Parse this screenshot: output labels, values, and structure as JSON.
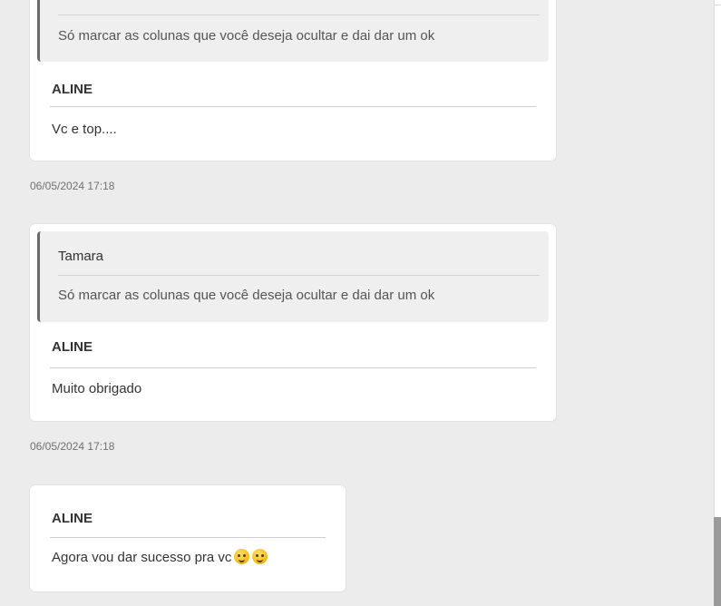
{
  "messages": [
    {
      "quote": {
        "text": "Só marcar as colunas que você deseja ocultar e dai dar um ok"
      },
      "author": "ALINE",
      "text": "Vc e top....",
      "timestamp": "06/05/2024 17:18"
    },
    {
      "quote": {
        "author": "Tamara",
        "text": "Só marcar as colunas que você deseja ocultar e dai dar um ok"
      },
      "author": "ALINE",
      "text": "Muito obrigado",
      "timestamp": "06/05/2024 17:18"
    },
    {
      "author": "ALINE",
      "text": "Agora vou dar sucesso pra vc",
      "emojis": [
        "smiling-face-emoji",
        "smiling-face-emoji"
      ]
    }
  ],
  "colors": {
    "chat_background": "#ececec",
    "card_background": "#ffffff",
    "quote_background": "#efefef",
    "quote_border": "#6a6a6a"
  }
}
